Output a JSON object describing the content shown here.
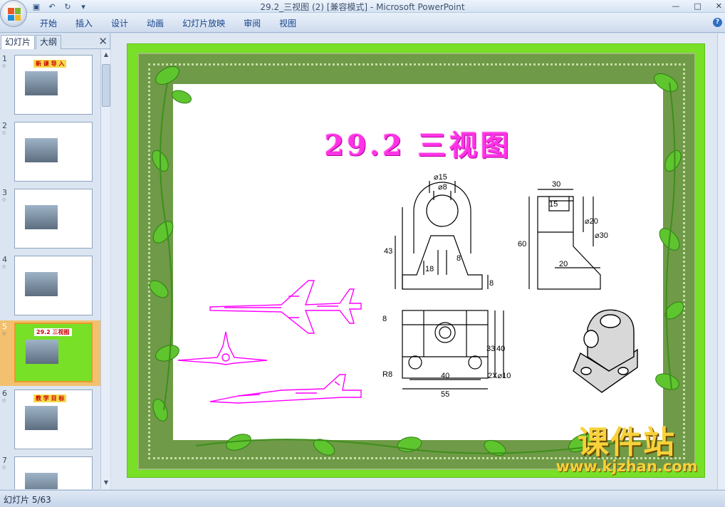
{
  "window": {
    "title": "29.2_三视图 (2) [兼容模式] - Microsoft PowerPoint"
  },
  "ribbon": {
    "tabs": [
      "开始",
      "插入",
      "设计",
      "动画",
      "幻灯片放映",
      "审阅",
      "视图"
    ]
  },
  "panel": {
    "tabs": {
      "slides": "幻灯片",
      "outline": "大纲"
    },
    "thumbnails": [
      {
        "num": "1",
        "heading": "新 课 导 入"
      },
      {
        "num": "2",
        "heading": ""
      },
      {
        "num": "3",
        "heading": ""
      },
      {
        "num": "4",
        "heading": ""
      },
      {
        "num": "5",
        "heading": "29.2 三视图"
      },
      {
        "num": "6",
        "heading": "教 学 目 标"
      },
      {
        "num": "7",
        "heading": ""
      }
    ],
    "selected_index": 4
  },
  "slide": {
    "title": "29.2  三视图",
    "dims": {
      "d15": "⌀15",
      "d8": "⌀8",
      "w30": "30",
      "w15": "15",
      "h43": "43",
      "h18": "18",
      "w8": "8",
      "h8": "8",
      "h60": "60",
      "d20": "⌀20",
      "d30": "⌀30",
      "w20": "20",
      "h8b": "8",
      "h33": "33",
      "h40": "40",
      "r8": "R8",
      "w40": "40",
      "holes": "2X⌀10",
      "w55": "55"
    }
  },
  "watermark": {
    "cn": "课件站",
    "url": "www.kjzhan.com"
  },
  "status": {
    "text": "幻灯片 5/63"
  },
  "colors": {
    "slide_bg": "#77e027",
    "title": "#ff33e6",
    "airplane": "#ff00ff",
    "watermark": "#f7d23b"
  }
}
